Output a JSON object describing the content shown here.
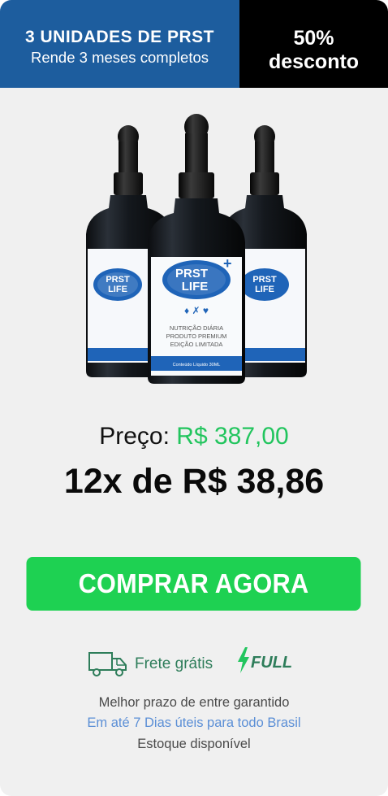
{
  "header": {
    "title": "3 UNIDADES DE PRST",
    "subtitle": "Rende 3 meses completos",
    "discount_percent": "50%",
    "discount_label": "desconto"
  },
  "product": {
    "brand_line1": "PRST",
    "brand_line2": "LIFE",
    "tag_line1": "NUTRIÇÃO DIÁRIA",
    "tag_line2": "PRODUTO PREMIUM",
    "tag_line3": "EDIÇÃO LIMITADA",
    "content_label": "Conteúdo Líquido 30ML"
  },
  "pricing": {
    "price_label": "Preço:",
    "price_value": "R$ 387,00",
    "installments": "12x de R$ 38,86"
  },
  "cta": {
    "label": "COMPRAR AGORA"
  },
  "shipping": {
    "label": "Frete grátis",
    "badge": "FULL",
    "line1": "Melhor prazo de entre garantido",
    "line2": "Em até 7 Dias úteis para todo Brasil",
    "line3": "Estoque disponível"
  },
  "colors": {
    "header_blue": "#1d5d9e",
    "accent_green": "#22c55e",
    "button_green": "#1ed152",
    "shipping_green": "#2e7d5a",
    "link_blue": "#5b8fd6"
  }
}
